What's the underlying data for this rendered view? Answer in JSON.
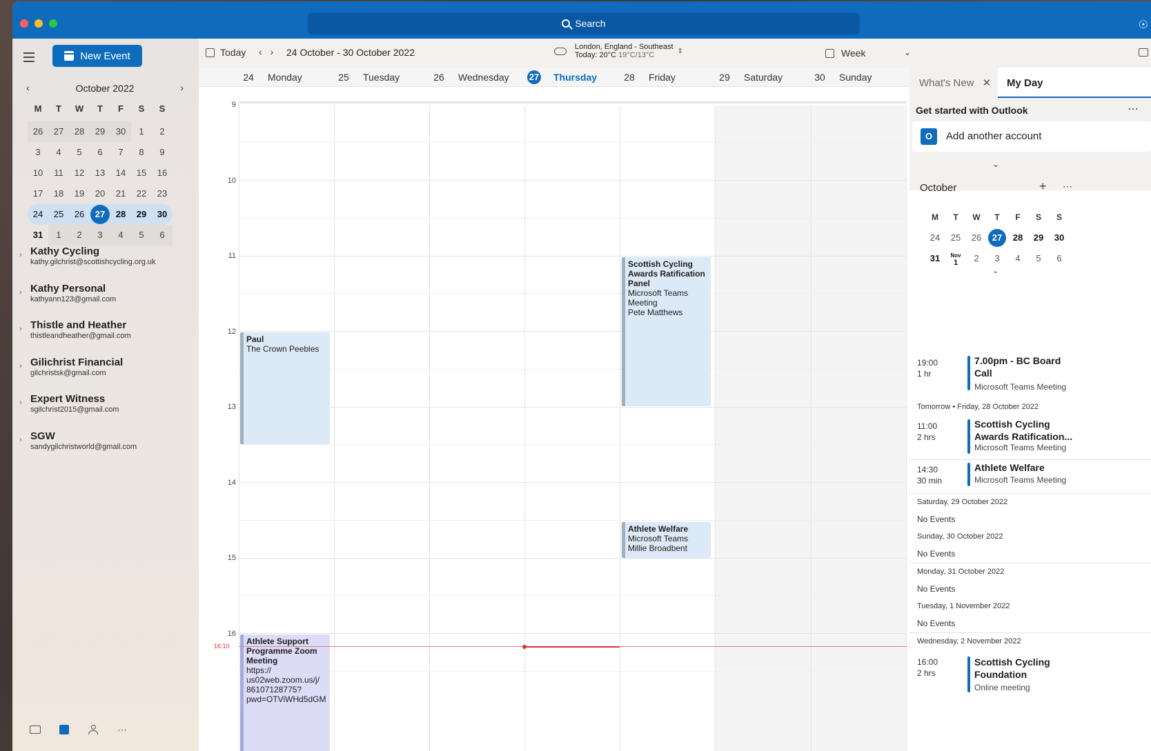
{
  "header": {
    "search_label": "Search"
  },
  "sidebar": {
    "new_event_label": "New Event",
    "mini_cal": {
      "title": "October 2022",
      "weekdays": [
        "M",
        "T",
        "W",
        "T",
        "F",
        "S",
        "S"
      ],
      "weeks": [
        [
          "26",
          "27",
          "28",
          "29",
          "30",
          "1",
          "2"
        ],
        [
          "3",
          "4",
          "5",
          "6",
          "7",
          "8",
          "9"
        ],
        [
          "10",
          "11",
          "12",
          "13",
          "14",
          "15",
          "16"
        ],
        [
          "17",
          "18",
          "19",
          "20",
          "21",
          "22",
          "23"
        ],
        [
          "24",
          "25",
          "26",
          "27",
          "28",
          "29",
          "30"
        ],
        [
          "31",
          "1",
          "2",
          "3",
          "4",
          "5",
          "6"
        ]
      ]
    },
    "accounts": [
      {
        "name": "Kathy Cycling",
        "email": "kathy.gilchrist@scottishcycling.org.uk"
      },
      {
        "name": "Kathy Personal",
        "email": "kathyann123@gmail.com"
      },
      {
        "name": "Thistle and Heather",
        "email": "thistleandheather@gmail.com"
      },
      {
        "name": "Gilichrist Financial",
        "email": "gilchristsk@gmail.com"
      },
      {
        "name": "Expert Witness",
        "email": "sgilchrist2015@gmail.com"
      },
      {
        "name": "SGW",
        "email": "sandygilchristworld@gmail.com"
      }
    ],
    "bottom_icons": [
      "mail-icon",
      "calendar-icon",
      "people-icon",
      "more-icon"
    ]
  },
  "toolbar": {
    "today_label": "Today",
    "date_range": "24 October - 30 October 2022",
    "weather_location": "London, England - Southeast",
    "weather_today": "Today: 20°C",
    "weather_range": "19°C/13°C",
    "view_label": "Week"
  },
  "calendar": {
    "days": [
      {
        "num": "24",
        "name": "Monday"
      },
      {
        "num": "25",
        "name": "Tuesday"
      },
      {
        "num": "26",
        "name": "Wednesday"
      },
      {
        "num": "27",
        "name": "Thursday"
      },
      {
        "num": "28",
        "name": "Friday"
      },
      {
        "num": "29",
        "name": "Saturday"
      },
      {
        "num": "30",
        "name": "Sunday"
      }
    ],
    "hours": [
      "9",
      "10",
      "11",
      "12",
      "13",
      "14",
      "15",
      "16"
    ],
    "now_label": "16:10",
    "events": [
      {
        "title": "Paul",
        "lines": [
          "The Crown Peebles"
        ]
      },
      {
        "title": "Scottish Cycling Awards Ratification Panel",
        "lines": [
          "Microsoft Teams Meeting",
          "Pete Matthews"
        ]
      },
      {
        "title": "Athlete Welfare",
        "lines": [
          "Microsoft Teams",
          "Millie Broadbent"
        ]
      },
      {
        "title": "Athlete Support Programme Zoom Meeting",
        "lines": [
          "https://",
          "us02web.zoom.us/j/",
          "86107128775?",
          "pwd=OTViWHd5dGM"
        ]
      }
    ]
  },
  "right_panel": {
    "tab_whats_new": "What's New",
    "tab_my_day": "My Day",
    "get_started_title": "Get started with Outlook",
    "add_account": "Add another account",
    "month_label": "October",
    "mini_weekdays": [
      "M",
      "T",
      "W",
      "T",
      "F",
      "S",
      "S"
    ],
    "mini_week1": [
      "24",
      "25",
      "26",
      "27",
      "28",
      "29",
      "30"
    ],
    "mini_week2": [
      "31",
      "Nov",
      "1",
      "2",
      "3",
      "4",
      "5",
      "6"
    ],
    "agenda": {
      "e1_time": "19:00",
      "e1_dur": "1 hr",
      "e1_title": "7.00pm - BC Board Call",
      "e1_sub": "Microsoft Teams Meeting",
      "tomorrow_label": "Tomorrow • Friday, 28 October 2022",
      "e2_time": "11:00",
      "e2_dur": "2 hrs",
      "e2_title": "Scottish Cycling Awards Ratification...",
      "e2_sub": "Microsoft Teams Meeting",
      "e3_time": "14:30",
      "e3_dur": "30 min",
      "e3_title": "Athlete Welfare",
      "e3_sub": "Microsoft Teams Meeting",
      "sat_label": "Saturday, 29 October 2022",
      "sun_label": "Sunday, 30 October 2022",
      "mon_label": "Monday, 31 October 2022",
      "tue_label": "Tuesday, 1 November 2022",
      "wed_label": "Wednesday, 2 November 2022",
      "no_events": "No Events",
      "e4_time": "16:00",
      "e4_dur": "2 hrs",
      "e4_title": "Scottish Cycling Foundation",
      "e4_sub": "Online meeting"
    }
  },
  "colors": {
    "accent": "#0f6cbd",
    "now_line": "#d13438",
    "event_bg": "#dce9f6",
    "event_purple": "#dcdcf7"
  }
}
